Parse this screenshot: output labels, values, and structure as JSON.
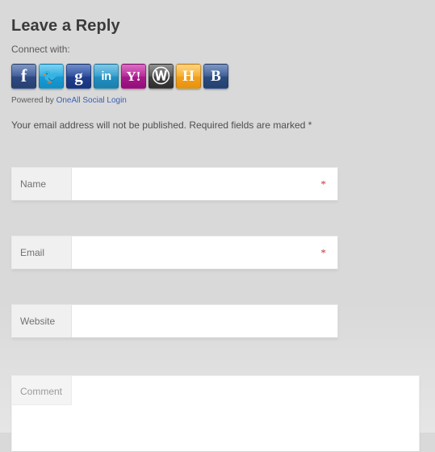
{
  "heading": "Leave a Reply",
  "social": {
    "connect_label": "Connect with:",
    "providers": [
      {
        "name": "facebook",
        "glyph": "f",
        "icon_name": "facebook-icon",
        "color": "#3a5795"
      },
      {
        "name": "twitter",
        "glyph": "🐦",
        "icon_name": "twitter-icon",
        "color": "#26a8e0"
      },
      {
        "name": "google",
        "glyph": "g",
        "icon_name": "google-icon",
        "color": "#27489b"
      },
      {
        "name": "linkedin",
        "glyph": "in",
        "icon_name": "linkedin-icon",
        "color": "#2e9ccc"
      },
      {
        "name": "yahoo",
        "glyph": "Y!",
        "icon_name": "yahoo-icon",
        "color": "#b32296"
      },
      {
        "name": "wordpress",
        "glyph": "Ⓦ",
        "icon_name": "wordpress-icon",
        "color": "#4d4d4d"
      },
      {
        "name": "hyves",
        "glyph": "H",
        "icon_name": "hyves-icon",
        "color": "#f7ab28"
      },
      {
        "name": "blogger",
        "glyph": "B",
        "icon_name": "blogger-icon",
        "color": "#35588f"
      }
    ],
    "powered_prefix": "Powered by ",
    "powered_link": "OneAll Social Login"
  },
  "form": {
    "note": "Your email address will not be published. Required fields are marked *",
    "required_marker": "*",
    "fields": {
      "name": {
        "label": "Name",
        "value": "",
        "placeholder": "",
        "required": true
      },
      "email": {
        "label": "Email",
        "value": "",
        "placeholder": "",
        "required": true
      },
      "website": {
        "label": "Website",
        "value": "",
        "placeholder": "",
        "required": false
      },
      "comment": {
        "label": "Comment",
        "value": "",
        "placeholder": "",
        "required": false
      }
    }
  },
  "colors": {
    "page_background": "#d9d9d9",
    "required_star": "#c0392b",
    "link": "#3a5fb5",
    "heading_text": "#3b3b3b"
  }
}
